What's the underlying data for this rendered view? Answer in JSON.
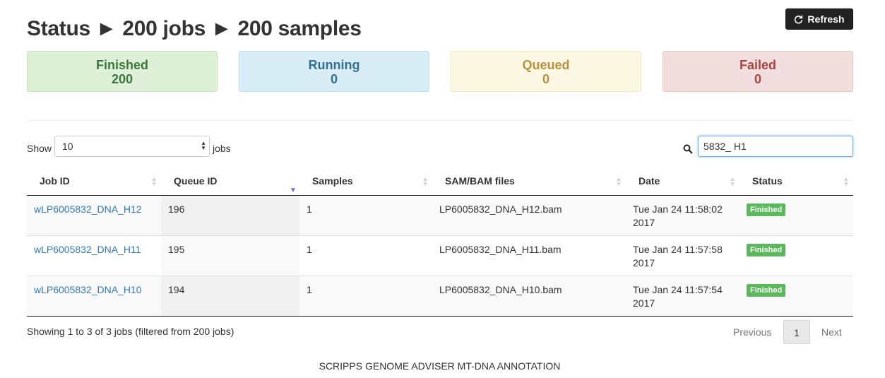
{
  "header": {
    "title": "Status ► 200 jobs ► 200 samples",
    "refresh_label": "Refresh"
  },
  "stats": {
    "finished": {
      "label": "Finished",
      "value": "200"
    },
    "running": {
      "label": "Running",
      "value": "0"
    },
    "queued": {
      "label": "Queued",
      "value": "0"
    },
    "failed": {
      "label": "Failed",
      "value": "0"
    }
  },
  "controls": {
    "show_label": "Show",
    "page_length": "10",
    "jobs_label": "jobs",
    "search_value": "5832_ H1"
  },
  "table": {
    "columns": [
      "Job ID",
      "Queue ID",
      "Samples",
      "SAM/BAM files",
      "Date",
      "Status"
    ],
    "sorted_column": "Queue ID",
    "sort_direction": "descending",
    "rows": [
      {
        "job_id": "wLP6005832_DNA_H12",
        "queue_id": "196",
        "samples": "1",
        "file": "LP6005832_DNA_H12.bam",
        "date": "Tue Jan 24 11:58:02",
        "year": "2017",
        "status": "Finished"
      },
      {
        "job_id": "wLP6005832_DNA_H11",
        "queue_id": "195",
        "samples": "1",
        "file": "LP6005832_DNA_H11.bam",
        "date": "Tue Jan 24 11:57:58",
        "year": "2017",
        "status": "Finished"
      },
      {
        "job_id": "wLP6005832_DNA_H10",
        "queue_id": "194",
        "samples": "1",
        "file": "LP6005832_DNA_H10.bam",
        "date": "Tue Jan 24 11:57:54",
        "year": "2017",
        "status": "Finished"
      }
    ]
  },
  "pagination": {
    "info": "Showing 1 to 3 of 3 jobs (filtered from 200 jobs)",
    "previous": "Previous",
    "current_page": "1",
    "next": "Next"
  },
  "footer": {
    "text": "SCRIPPS GENOME ADVISER MT-DNA ANNOTATION"
  },
  "colors": {
    "finished_bg": "#dff0d8",
    "running_bg": "#d9edf7",
    "queued_bg": "#fcf8e3",
    "failed_bg": "#f2dede",
    "link": "#337ab7",
    "badge": "#5cb85c"
  }
}
